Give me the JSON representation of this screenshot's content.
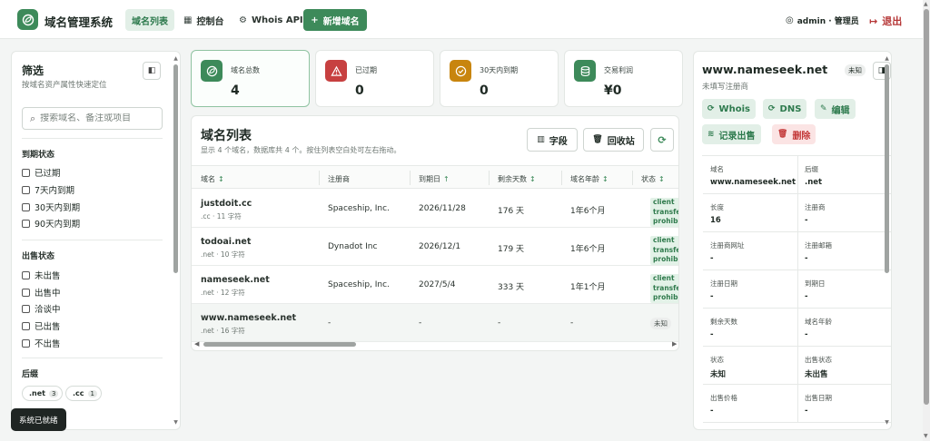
{
  "app": {
    "title": "域名管理系统"
  },
  "nav": {
    "domain_list": "域名列表",
    "dashboard": "控制台",
    "whois_api": "Whois API",
    "add_domain": "新增域名",
    "user": "admin · 管理员",
    "logout": "退出"
  },
  "filters": {
    "title": "筛选",
    "subtitle": "按域名资产属性快速定位",
    "search_placeholder": "搜索域名、备注或项目",
    "expiry_group": "到期状态",
    "expiry_options": [
      "已过期",
      "7天内到期",
      "30天内到期",
      "90天内到期"
    ],
    "sale_group": "出售状态",
    "sale_options": [
      "未出售",
      "出售中",
      "洽谈中",
      "已出售",
      "不出售"
    ],
    "suffix_group": "后缀",
    "suffixes": [
      {
        "label": ".net",
        "count": "3"
      },
      {
        "label": ".cc",
        "count": "1"
      }
    ]
  },
  "toast": "系统已就绪",
  "stats": [
    {
      "label": "域名总数",
      "value": "4",
      "color": "#3d8a5a"
    },
    {
      "label": "已过期",
      "value": "0",
      "color": "#c74040"
    },
    {
      "label": "30天内到期",
      "value": "0",
      "color": "#c8850e"
    },
    {
      "label": "交易利润",
      "value": "¥0",
      "color": "#3d8a5a"
    }
  ],
  "list": {
    "title": "域名列表",
    "subtitle": "显示 4 个域名，数据库共 4 个。按住列表空白处可左右拖动。",
    "fields_button": "字段",
    "recycle_button": "回收站",
    "columns": [
      "域名",
      "注册商",
      "到期日",
      "剩余天数",
      "域名年龄",
      "状态"
    ],
    "rows": [
      {
        "name": "justdoit.cc",
        "meta": ".cc · 11 字符",
        "registrar": "Spaceship, Inc.",
        "expiry": "2026/11/28",
        "days": "176 天",
        "age": "1年6个月",
        "status": "client transfer prohibited"
      },
      {
        "name": "todoai.net",
        "meta": ".net · 10 字符",
        "registrar": "Dynadot Inc",
        "expiry": "2026/12/1",
        "days": "179 天",
        "age": "1年6个月",
        "status": "client transfer prohibited"
      },
      {
        "name": "nameseek.net",
        "meta": ".net · 12 字符",
        "registrar": "Spaceship, Inc.",
        "expiry": "2027/5/4",
        "days": "333 天",
        "age": "1年1个月",
        "status": "client transfer prohibited"
      },
      {
        "name": "www.nameseek.net",
        "meta": ".net · 16 字符",
        "registrar": "-",
        "expiry": "-",
        "days": "-",
        "age": "-",
        "status": "未知"
      }
    ]
  },
  "detail": {
    "title": "www.nameseek.net",
    "status_badge": "未知",
    "registrar_note": "未填写注册商",
    "actions": {
      "whois": "Whois",
      "dns": "DNS",
      "edit": "编辑",
      "record_sale": "记录出售",
      "delete": "删除"
    },
    "fields": [
      {
        "key": "域名",
        "value": "www.nameseek.net"
      },
      {
        "key": "后缀",
        "value": ".net"
      },
      {
        "key": "长度",
        "value": "16"
      },
      {
        "key": "注册商",
        "value": "-"
      },
      {
        "key": "注册商网址",
        "value": "-"
      },
      {
        "key": "注册邮箱",
        "value": "-"
      },
      {
        "key": "注册日期",
        "value": "-"
      },
      {
        "key": "到期日",
        "value": "-"
      },
      {
        "key": "剩余天数",
        "value": "-"
      },
      {
        "key": "域名年龄",
        "value": "-"
      },
      {
        "key": "状态",
        "value": "未知"
      },
      {
        "key": "出售状态",
        "value": "未出售"
      },
      {
        "key": "出售价格",
        "value": "-"
      },
      {
        "key": "出售日期",
        "value": "-"
      }
    ]
  }
}
